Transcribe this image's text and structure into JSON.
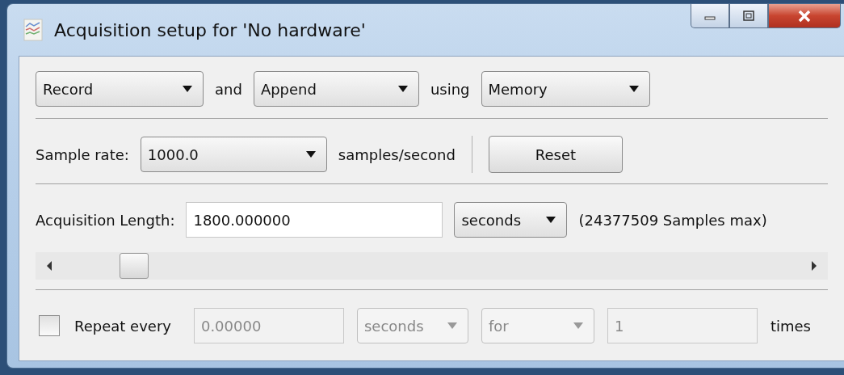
{
  "window": {
    "title": "Acquisition setup for 'No hardware'"
  },
  "mode_row": {
    "items": [
      {
        "kind": "combo",
        "value": "Record",
        "disabled": false
      },
      {
        "kind": "label",
        "text": "and"
      },
      {
        "kind": "combo",
        "value": "Append",
        "disabled": false
      },
      {
        "kind": "label",
        "text": "using"
      },
      {
        "kind": "combo",
        "value": "Memory",
        "disabled": false
      }
    ]
  },
  "rate_row": {
    "label": "Sample rate:",
    "combo": {
      "value": "1000.0",
      "disabled": false
    },
    "unit": "samples/second",
    "reset_button": "Reset"
  },
  "length_row": {
    "label": "Acquisition Length:",
    "field": {
      "value": "1800.000000"
    },
    "unit_combo": {
      "value": "seconds",
      "disabled": false
    },
    "max_note": "(24377509 Samples max)"
  },
  "length_slider": {
    "level": 0.08
  },
  "repeat_row": {
    "checkbox": {
      "label": "Repeat every",
      "checked": false
    },
    "interval_field": {
      "value": "0.00000",
      "disabled": true
    },
    "unit_combo": {
      "value": "seconds",
      "disabled": true
    },
    "mode_combo": {
      "value": "for",
      "disabled": true
    },
    "count_field": {
      "value": "1",
      "disabled": true
    },
    "suffix": "times"
  }
}
